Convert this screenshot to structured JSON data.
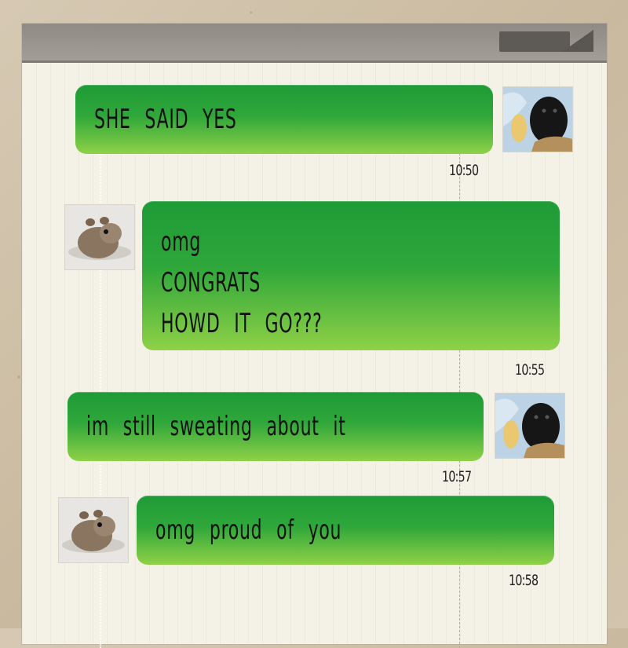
{
  "messages": [
    {
      "side": "right",
      "text": "SHE SAID YES",
      "time": "10:50",
      "avatar": "kitten-in-blanket"
    },
    {
      "side": "left",
      "text": "omg\nCONGRATS\nHOWD IT GO???",
      "time": "10:55",
      "avatar": "hamster"
    },
    {
      "side": "right",
      "text": "im still sweating about it",
      "time": "10:57",
      "avatar": "kitten-in-blanket"
    },
    {
      "side": "left",
      "text": "omg proud of you",
      "time": "10:58",
      "avatar": "hamster"
    }
  ],
  "colors": {
    "bubble_top": "#1e9b37",
    "bubble_bottom": "#8fd147",
    "paper": "#f4f1e6",
    "titlebar": "#9a968f"
  }
}
